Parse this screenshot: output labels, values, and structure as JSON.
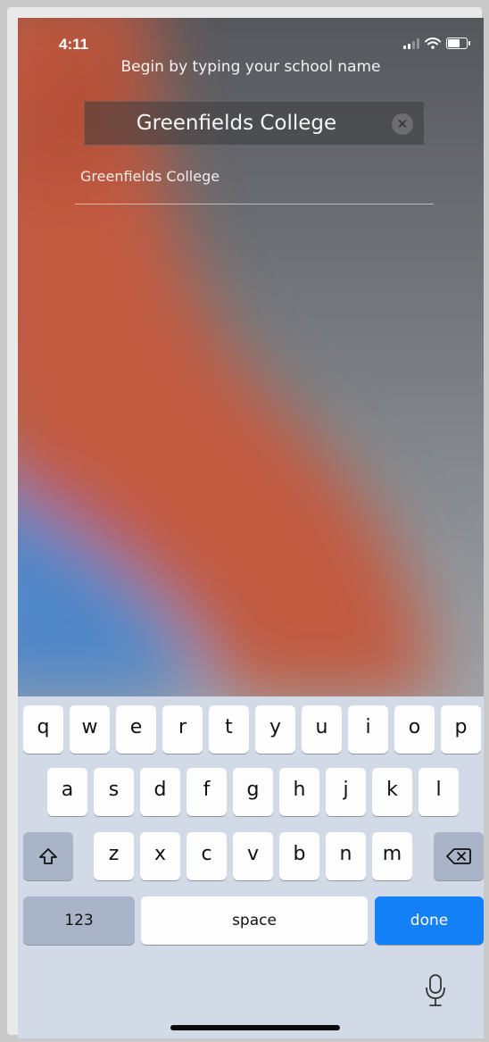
{
  "status_bar": {
    "time": "4:11"
  },
  "school_search": {
    "prompt": "Begin by typing your school name",
    "query": "Greenfields College",
    "clear_icon": "x-circle-icon"
  },
  "results": [
    {
      "label": "Greenfields College"
    }
  ],
  "keyboard": {
    "row1": [
      "q",
      "w",
      "e",
      "r",
      "t",
      "y",
      "u",
      "i",
      "o",
      "p"
    ],
    "row2": [
      "a",
      "s",
      "d",
      "f",
      "g",
      "h",
      "j",
      "k",
      "l"
    ],
    "row3": [
      "z",
      "x",
      "c",
      "v",
      "b",
      "n",
      "m"
    ],
    "numbers_label": "123",
    "space_label": "space",
    "done_label": "done",
    "done_color": "#1380f7"
  }
}
